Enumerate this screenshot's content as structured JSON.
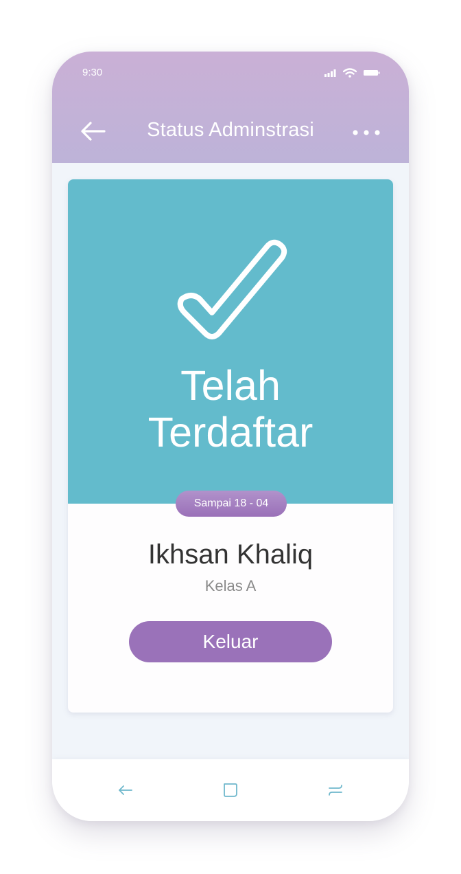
{
  "status_bar": {
    "time": "9:30",
    "icons": [
      "signal-icon",
      "wifi-icon",
      "battery-icon"
    ]
  },
  "header": {
    "title": "Status Adminstrasi",
    "back_icon": "arrow-left-icon",
    "more_icon": "more-dots-icon"
  },
  "status_card": {
    "icon": "checkmark-icon",
    "status_line1": "Telah",
    "status_line2": "Terdaftar",
    "valid_until": "Sampai 18 - 04",
    "student_name": "Ikhsan Khaliq",
    "student_class": "Kelas A",
    "logout_label": "Keluar"
  },
  "bottom_nav": {
    "items": [
      "back-nav-icon",
      "home-nav-icon",
      "recents-nav-icon"
    ]
  },
  "colors": {
    "header_gradient_top": "#cab0d6",
    "header_gradient_bottom": "#bdb3d8",
    "status_panel": "#63bbcc",
    "accent_purple": "#9a72b9",
    "nav_icon": "#6fb8cc",
    "background": "#f1f5fa"
  }
}
